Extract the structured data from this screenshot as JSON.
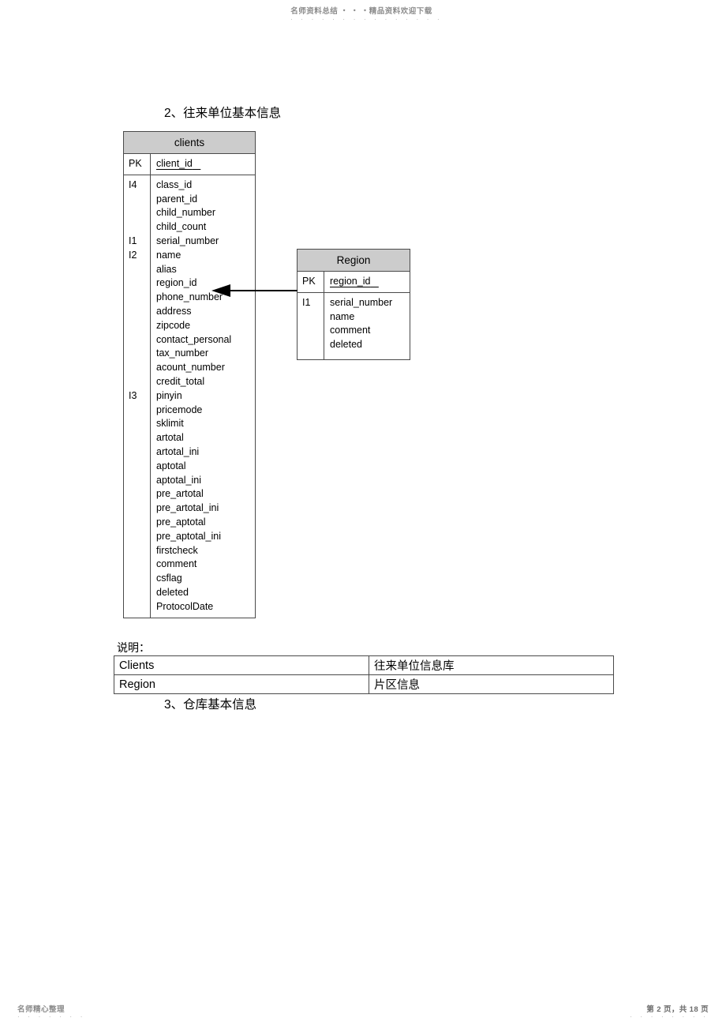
{
  "watermark": {
    "top_text": "名师资料总结 ‧ ‧ ‧精品资料欢迎下载",
    "top_dots": "· · · · · · · · · · · · · · ·",
    "footer_text": "名师精心整理",
    "footer_dots": "· · · · · · ·",
    "page_number": "第 2 页，共 18 页",
    "page_number_dots": "· · · · · · · ·"
  },
  "headings": {
    "section_2": "2、往来单位基本信息",
    "section_3": "3、仓库基本信息"
  },
  "diagram": {
    "entities": [
      {
        "name": "clients",
        "pk_key": "PK",
        "pk_field": "client_id",
        "keys": [
          "I4",
          "",
          "",
          "",
          "I1",
          "I2",
          "",
          "",
          "",
          "",
          "",
          "",
          "",
          "",
          "",
          "I3",
          "",
          "",
          "",
          "",
          "",
          "",
          "",
          "",
          "",
          "",
          "",
          "",
          "",
          "",
          ""
        ],
        "fields": [
          "class_id",
          "parent_id",
          "child_number",
          "child_count",
          "serial_number",
          "name",
          "alias",
          "region_id",
          "phone_number",
          "address",
          "zipcode",
          "contact_personal",
          "tax_number",
          "acount_number",
          "credit_total",
          "pinyin",
          "pricemode",
          "sklimit",
          "artotal",
          "artotal_ini",
          "aptotal",
          "aptotal_ini",
          "pre_artotal",
          "pre_artotal_ini",
          "pre_aptotal",
          "pre_aptotal_ini",
          "firstcheck",
          "comment",
          "csflag",
          "deleted",
          "ProtocolDate"
        ]
      },
      {
        "name": "Region",
        "pk_key": "PK",
        "pk_field": "region_id",
        "keys": [
          "I1",
          "",
          "",
          ""
        ],
        "fields": [
          "serial_number",
          "name",
          "comment",
          "deleted"
        ]
      }
    ],
    "relationship": {
      "from": "Region",
      "to": "clients.region_id",
      "style": "arrow-left"
    }
  },
  "legend": {
    "label": "说明：",
    "rows": [
      {
        "table": "Clients",
        "description": "往来单位信息库"
      },
      {
        "table": "Region",
        "description": "片区信息"
      }
    ]
  },
  "colors": {
    "entity_header_bg": "#cccccc",
    "border": "#4a4a4a",
    "text": "#000000",
    "watermark": "#8c8c8c"
  }
}
